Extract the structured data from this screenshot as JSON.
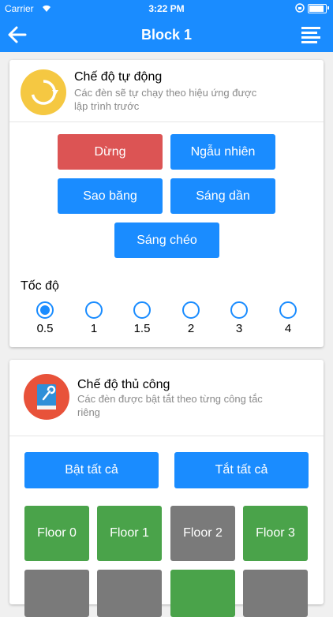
{
  "status": {
    "carrier": "Carrier",
    "time": "3:22 PM"
  },
  "nav": {
    "title": "Block 1",
    "back_icon": "back-arrow-icon",
    "menu_icon": "list-menu-icon"
  },
  "auto_mode": {
    "title": "Chế độ tự động",
    "desc_line1": "Các đèn sẽ tự chạy theo hiệu ứng được",
    "desc_line2": "lập trình trước",
    "icon": "refresh-icon",
    "buttons": [
      {
        "label": "Dừng",
        "color": "#dc5454"
      },
      {
        "label": "Ngẫu nhiên",
        "color": "#1a8cff"
      },
      {
        "label": "Sao băng",
        "color": "#1a8cff"
      },
      {
        "label": "Sáng dần",
        "color": "#1a8cff"
      },
      {
        "label": "Sáng chéo",
        "color": "#1a8cff"
      }
    ],
    "speed_label": "Tốc độ",
    "speeds": [
      "0.5",
      "1",
      "1.5",
      "2",
      "3",
      "4"
    ],
    "selected_speed": "0.5"
  },
  "manual_mode": {
    "title": "Chế độ thủ công",
    "desc_line1": "Các đèn được bật tắt theo từng công tắc",
    "desc_line2": "riêng",
    "icon": "manual-book-icon",
    "all_on": "Bật tất cả",
    "all_off": "Tắt tất cả",
    "floors": [
      {
        "label": "Floor 0",
        "state": "on"
      },
      {
        "label": "Floor 1",
        "state": "on"
      },
      {
        "label": "Floor 2",
        "state": "off"
      },
      {
        "label": "Floor 3",
        "state": "on"
      },
      {
        "label": "",
        "state": "off"
      },
      {
        "label": "",
        "state": "off"
      },
      {
        "label": "",
        "state": "on"
      },
      {
        "label": "",
        "state": "off"
      }
    ]
  },
  "colors": {
    "primary": "#1a8cff",
    "stop": "#dc5454",
    "on": "#4aa34a",
    "off": "#7a7a7a"
  }
}
